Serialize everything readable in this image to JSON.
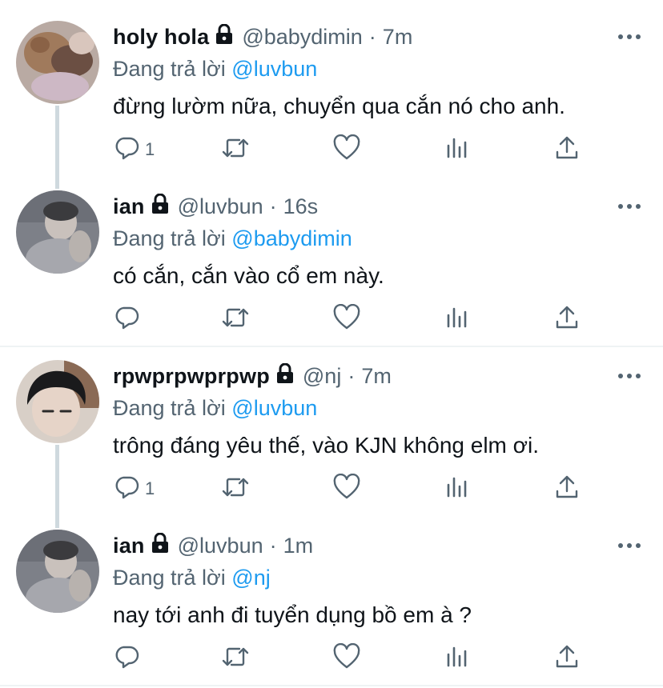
{
  "colors": {
    "link": "#1d9bf0",
    "secondary": "#536471",
    "text": "#0f1419",
    "thread_line": "#cfd9de"
  },
  "icons": [
    "reply-icon",
    "retweet-icon",
    "like-icon",
    "analytics-icon",
    "share-icon",
    "lock-icon",
    "more-icon"
  ],
  "tweets": [
    {
      "name": "holy hola",
      "handle": "@babydimin",
      "dot": "·",
      "time": "7m",
      "reply_prefix": "Đang trả lời",
      "reply_to": "@luvbun",
      "text": "đừng lườm nữa, chuyển qua cắn nó cho anh.",
      "reply_count": "1"
    },
    {
      "name": "ian",
      "handle": "@luvbun",
      "dot": "·",
      "time": "16s",
      "reply_prefix": "Đang trả lời",
      "reply_to": "@babydimin",
      "text": "có cắn, cắn vào cổ em này.",
      "reply_count": ""
    },
    {
      "name": "rpwprpwprpwp",
      "handle": "@nj",
      "dot": "·",
      "time": "7m",
      "reply_prefix": "Đang trả lời",
      "reply_to": "@luvbun",
      "text": "trông đáng yêu thế, vào KJN không elm ơi.",
      "reply_count": "1"
    },
    {
      "name": "ian",
      "handle": "@luvbun",
      "dot": "·",
      "time": "1m",
      "reply_prefix": "Đang trả lời",
      "reply_to": "@nj",
      "text": "nay tới anh đi tuyển dụng bồ em à ?",
      "reply_count": ""
    }
  ]
}
